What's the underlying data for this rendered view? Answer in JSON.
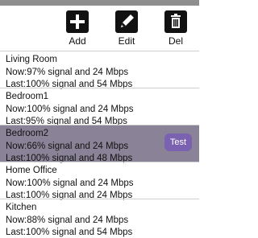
{
  "toolbar": {
    "add_label": "Add",
    "edit_label": "Edit",
    "del_label": "Del"
  },
  "locations": [
    {
      "name": "Living Room",
      "now": "Now:97% signal and 24 Mbps",
      "last": "Last:100% signal and 54 Mbps"
    },
    {
      "name": "Bedroom1",
      "now": "Now:100% signal and 24 Mbps",
      "last": "Last:95% signal and 54 Mbps"
    },
    {
      "name": "Bedroom2",
      "now": "Now:66% signal and 24 Mbps",
      "last": "Last:100% signal and 48 Mbps"
    },
    {
      "name": "Home Office",
      "now": "Now:100% signal and 24 Mbps",
      "last": "Last:100% signal and 24 Mbps"
    },
    {
      "name": "Kitchen",
      "now": "Now:88% signal and 24 Mbps",
      "last": "Last:100% signal and 54 Mbps"
    }
  ],
  "test_button_label": "Test",
  "colors": {
    "selected_row": "#8a8397",
    "test_button": "#7a62b0"
  }
}
